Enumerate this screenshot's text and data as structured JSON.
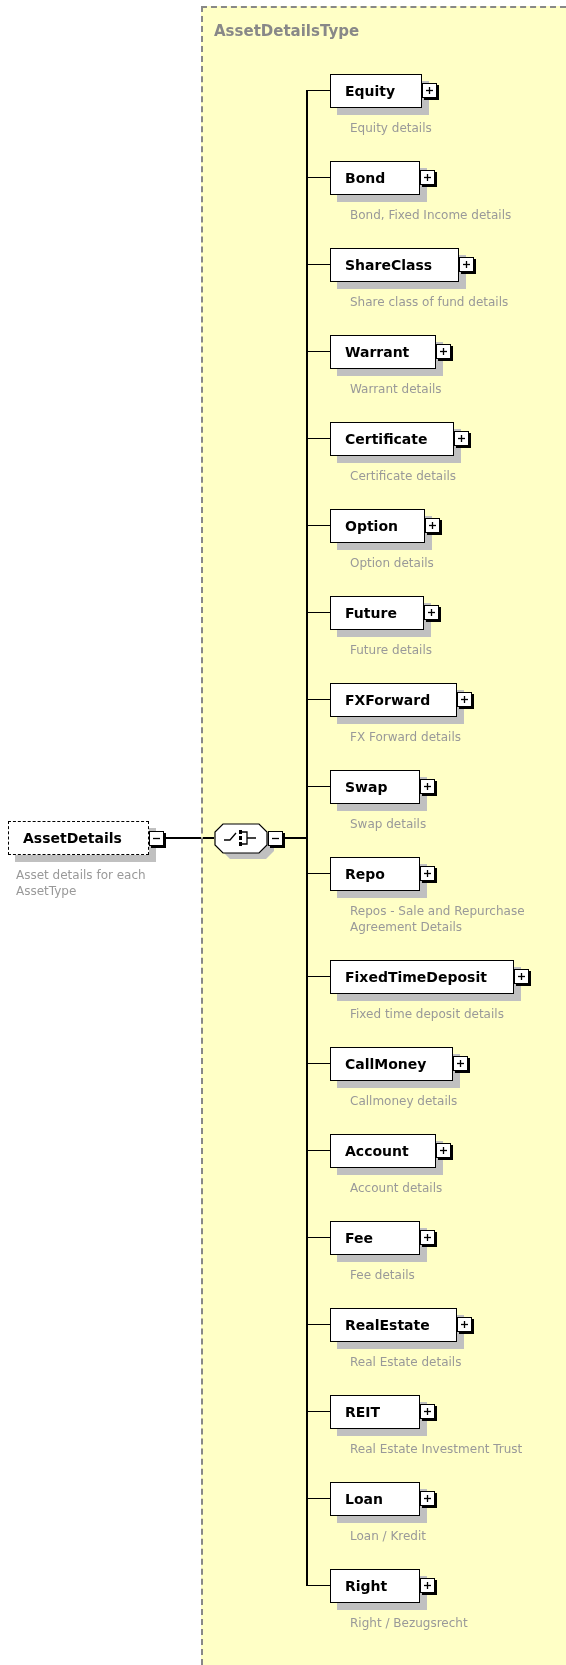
{
  "element": {
    "name": "AssetDetails",
    "description": "Asset details for each AssetType",
    "optional": true,
    "expanded": true
  },
  "type_name": "AssetDetailsType",
  "compositor": {
    "kind": "choice",
    "expanded": true
  },
  "children": [
    {
      "name": "Equity",
      "description": "Equity details",
      "expanded": false
    },
    {
      "name": "Bond",
      "description": "Bond, Fixed Income details",
      "expanded": false
    },
    {
      "name": "ShareClass",
      "description": "Share class of fund details",
      "expanded": false
    },
    {
      "name": "Warrant",
      "description": "Warrant details",
      "expanded": false
    },
    {
      "name": "Certificate",
      "description": "Certificate details",
      "expanded": false
    },
    {
      "name": "Option",
      "description": "Option details",
      "expanded": false
    },
    {
      "name": "Future",
      "description": "Future details",
      "expanded": false
    },
    {
      "name": "FXForward",
      "description": "FX Forward details",
      "expanded": false
    },
    {
      "name": "Swap",
      "description": "Swap details",
      "expanded": false
    },
    {
      "name": "Repo",
      "description": "Repos - Sale and Repurchase Agreement Details",
      "expanded": false
    },
    {
      "name": "FixedTimeDeposit",
      "description": "Fixed time deposit details",
      "expanded": false
    },
    {
      "name": "CallMoney",
      "description": "Callmoney details",
      "expanded": false
    },
    {
      "name": "Account",
      "description": "Account details",
      "expanded": false
    },
    {
      "name": "Fee",
      "description": "Fee details",
      "expanded": false
    },
    {
      "name": "RealEstate",
      "description": "Real Estate details",
      "expanded": false
    },
    {
      "name": "REIT",
      "description": "Real Estate Investment Trust",
      "expanded": false
    },
    {
      "name": "Loan",
      "description": "Loan / Kredit",
      "expanded": false
    },
    {
      "name": "Right",
      "description": "Right / Bezugsrecht",
      "expanded": false
    }
  ]
}
